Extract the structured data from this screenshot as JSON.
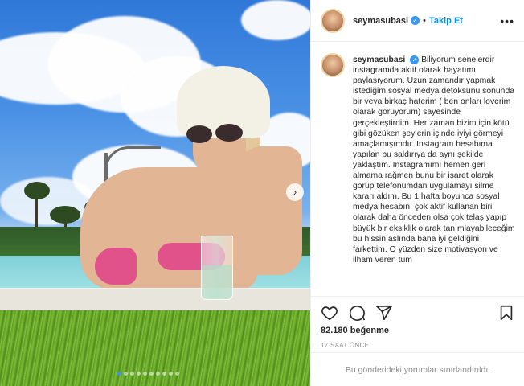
{
  "post": {
    "username": "seymasubasi",
    "separator": "•",
    "follow_label": "Takip Et",
    "more_label": "•••",
    "next_label": "›",
    "caption": "Biliyorum senelerdir instagramda aktif olarak hayatımı paylaşıyorum. Uzun zamandır yapmak istediğim sosyal medya detoksunu sonunda bir veya birkaç haterim ( ben onları loverim olarak görüyorum) sayesinde gerçekleştirdim. Her zaman bizim için kötü gibi gözüken şeylerin içinde iyiyi görmeyi amaçlamışımdır. Instagram hesabıma yapılan bu saldırıya da aynı şekilde yaklaştım. Instagramımı hemen geri almama rağmen bunu bir işaret olarak görüp telefonumdan uygulamayı silme kararı aldım. Bu 1 hafta boyunca sosyal medya hesabını çok aktif kullanan biri olarak daha önceden olsa çok telaş yapıp büyük bir eksiklik olarak tanımlayabileceğim bu hissin aslında bana iyi geldiğini farkettim. O yüzden size motivasyon ve ilham veren tüm",
    "likes": "82.180 beğenme",
    "time": "17 SAAT ÖNCE",
    "comments_notice": "Bu gönderideki yorumlar sınırlandırıldı.",
    "carousel": {
      "count": 10,
      "active_index": 0
    }
  },
  "icons": {
    "like": "heart-icon",
    "comment": "comment-icon",
    "share": "share-icon",
    "save": "bookmark-icon",
    "verified": "verified-badge-icon"
  },
  "colors": {
    "accent": "#0095f6",
    "verified": "#3897f0",
    "muted": "#8e8e8e"
  }
}
